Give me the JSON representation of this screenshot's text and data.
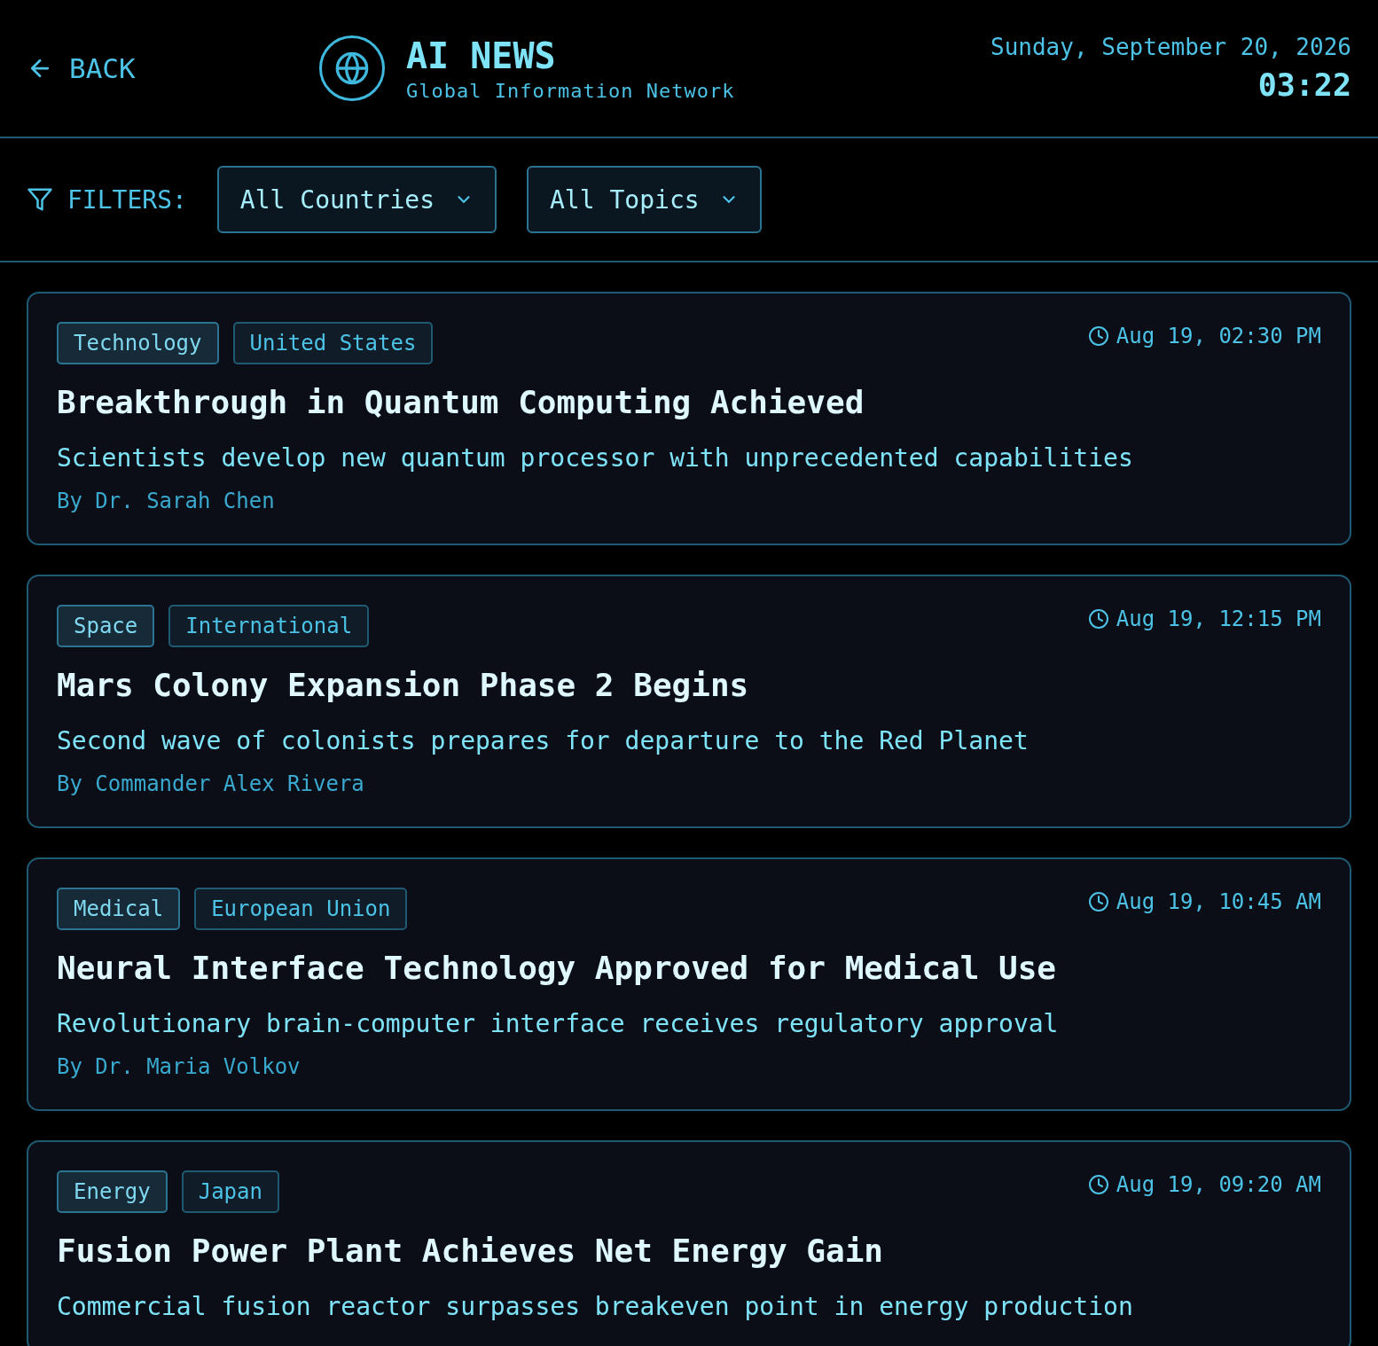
{
  "header": {
    "back": "BACK",
    "title": "AI NEWS",
    "subtitle": "Global Information Network",
    "date": "Sunday, September 20, 2026",
    "time": "03:22"
  },
  "filters": {
    "label": "FILTERS:",
    "selects": [
      "All Countries",
      "All Topics"
    ]
  },
  "articles": [
    {
      "tags": [
        {
          "label": "Technology",
          "kind": "topic"
        },
        {
          "label": "United States",
          "kind": "country"
        }
      ],
      "time": "Aug 19, 02:30 PM",
      "title": "Breakthrough in Quantum Computing Achieved",
      "summary": "Scientists develop new quantum processor with unprecedented capabilities",
      "author": "By Dr. Sarah Chen"
    },
    {
      "tags": [
        {
          "label": "Space",
          "kind": "topic"
        },
        {
          "label": "International",
          "kind": "country"
        }
      ],
      "time": "Aug 19, 12:15 PM",
      "title": "Mars Colony Expansion Phase 2 Begins",
      "summary": "Second wave of colonists prepares for departure to the Red Planet",
      "author": "By Commander Alex Rivera"
    },
    {
      "tags": [
        {
          "label": "Medical",
          "kind": "topic"
        },
        {
          "label": "European Union",
          "kind": "country"
        }
      ],
      "time": "Aug 19, 10:45 AM",
      "title": "Neural Interface Technology Approved for Medical Use",
      "summary": "Revolutionary brain-computer interface receives regulatory approval",
      "author": "By Dr. Maria Volkov"
    },
    {
      "tags": [
        {
          "label": "Energy",
          "kind": "topic"
        },
        {
          "label": "Japan",
          "kind": "country"
        }
      ],
      "time": "Aug 19, 09:20 AM",
      "title": "Fusion Power Plant Achieves Net Energy Gain",
      "summary": "Commercial fusion reactor surpasses breakeven point in energy production"
    }
  ]
}
